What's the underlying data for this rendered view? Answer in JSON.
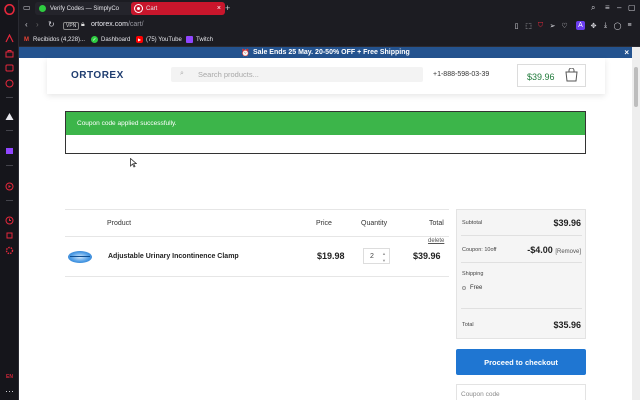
{
  "browser": {
    "tabs": [
      {
        "title": "Verify Codes — SimplyCo",
        "active": false,
        "icon": "check-circle-icon",
        "icon_color": "#2ecc40"
      },
      {
        "title": "Cart",
        "active": true,
        "icon": "opera-icon",
        "icon_color": "#ffffff"
      }
    ],
    "vpn_label": "VPN",
    "url_host": "ortorex.com",
    "url_path": "/cart/",
    "accent_color": "#c8162c",
    "bookmarks": [
      {
        "label": "Recibidos (4,228)...",
        "icon": "gmail-icon"
      },
      {
        "label": "Dashboard",
        "icon": "check-circle-icon"
      },
      {
        "label": "(75) YouTube",
        "icon": "youtube-icon"
      },
      {
        "label": "Twitch",
        "icon": "twitch-icon"
      }
    ],
    "sidebar_badge": "EN"
  },
  "promo": {
    "text": "Sale Ends 25 May. 20-50% OFF + Free Shipping",
    "close": "×",
    "bg_color": "#24538f"
  },
  "header": {
    "logo": "ORTOREX",
    "search_placeholder": "Search products...",
    "phone": "+1-888-598-03-39",
    "cart_total": "$39.96"
  },
  "notice": {
    "message": "Coupon code applied successfully.",
    "color": "#3cb54a"
  },
  "cart": {
    "columns": [
      "Product",
      "Price",
      "Quantity",
      "Total"
    ],
    "items": [
      {
        "name": "Adjustable Urinary Incontinence Clamp",
        "price": "$19.98",
        "quantity": "2",
        "total": "$39.96",
        "delete_label": "delete"
      }
    ]
  },
  "summary": {
    "subtotal_label": "Subtotal",
    "subtotal": "$39.96",
    "coupon_label": "Coupon: 10off",
    "coupon_amount": "-$4.00",
    "remove_label": "[Remove]",
    "shipping_label": "Shipping",
    "shipping_option": "Free",
    "total_label": "Total",
    "total": "$35.96"
  },
  "checkout": {
    "button_label": "Proceed to checkout",
    "button_color": "#1f76d2",
    "coupon_placeholder": "Coupon code"
  }
}
